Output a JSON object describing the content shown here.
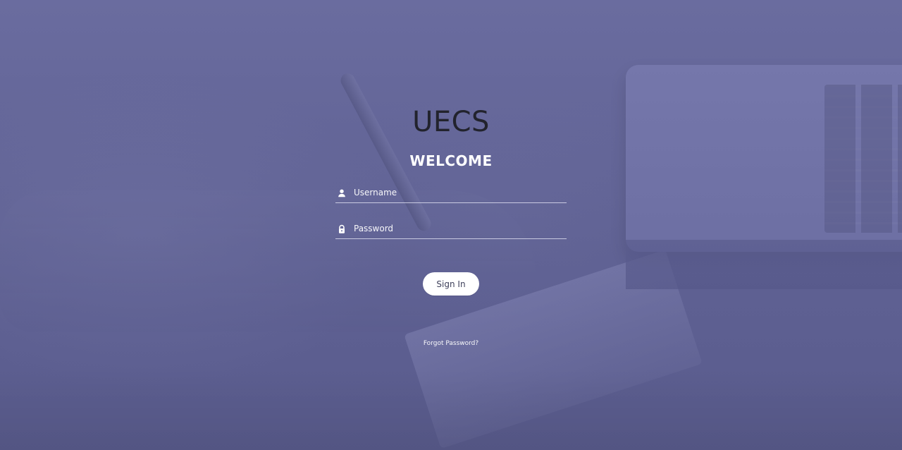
{
  "brand": {
    "title": "UECS"
  },
  "auth": {
    "heading": "WELCOME",
    "username": {
      "value": "",
      "placeholder": "Username",
      "icon": "user-icon"
    },
    "password": {
      "value": "",
      "placeholder": "Password",
      "icon": "lock-icon"
    },
    "submit_label": "Sign In",
    "forgot_label": "Forgot Password?"
  }
}
